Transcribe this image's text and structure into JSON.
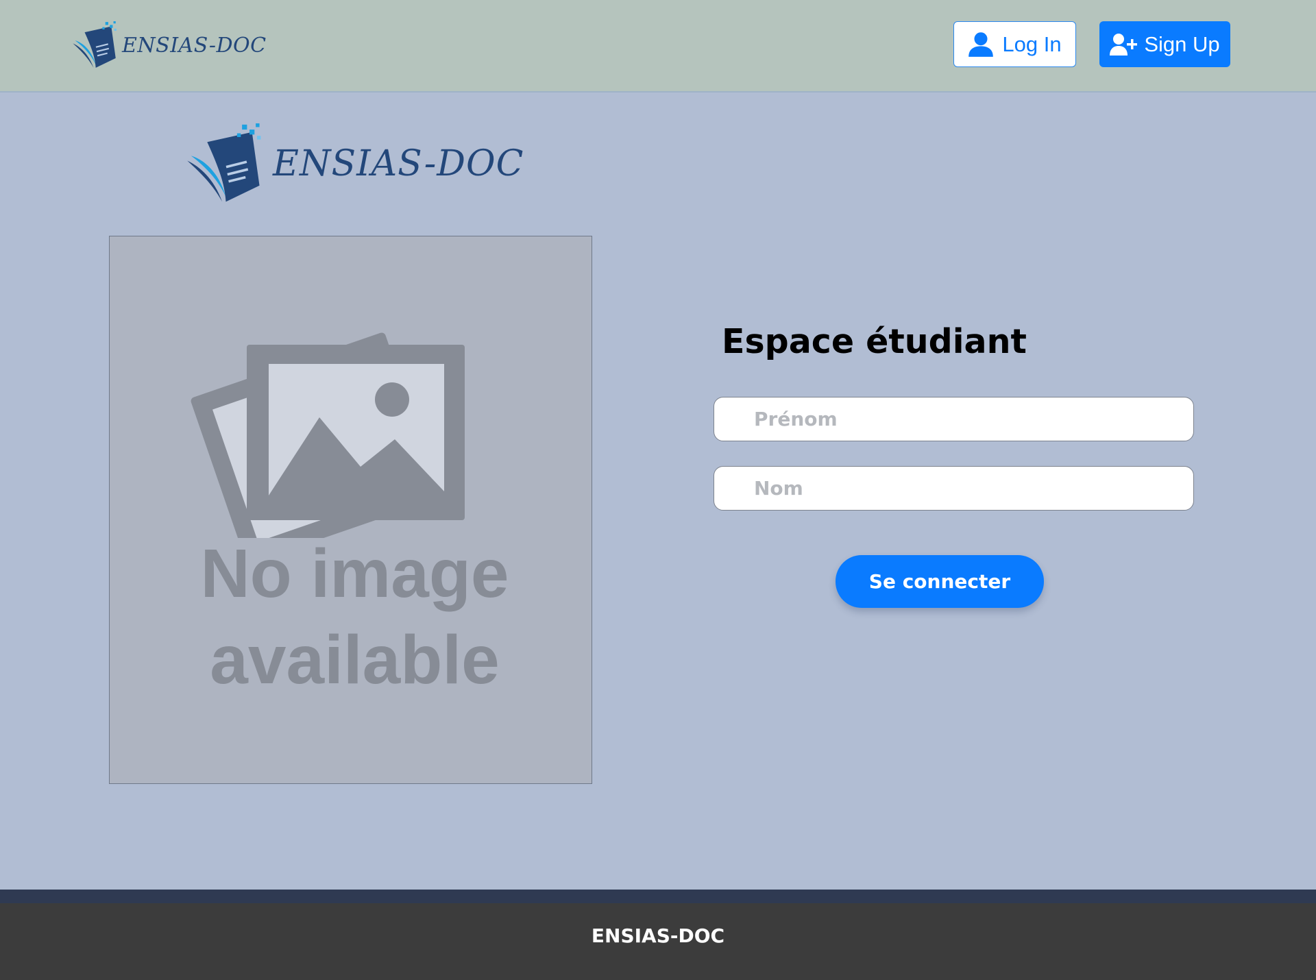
{
  "header": {
    "brand": "ENSIAS-DOC",
    "login_label": "Log In",
    "signup_label": "Sign Up"
  },
  "main": {
    "brand": "ENSIAS-DOC",
    "placeholder_image": {
      "line1": "No image",
      "line2": "available"
    },
    "form": {
      "title": "Espace étudiant",
      "first_name": {
        "placeholder": "Prénom",
        "value": ""
      },
      "last_name": {
        "placeholder": "Nom",
        "value": ""
      },
      "submit_label": "Se connecter"
    }
  },
  "footer": {
    "text": "ENSIAS-DOC"
  },
  "icons": {
    "login": "user-icon",
    "signup": "user-plus-icon",
    "logo": "document-logo-icon",
    "placeholder": "image-placeholder-icon"
  },
  "colors": {
    "header_bg": "#b5c4bd",
    "page_bg": "#b1bdd3",
    "accent": "#0a7bff",
    "brand": "#23477a",
    "footer_bg": "#3c3c3c"
  }
}
